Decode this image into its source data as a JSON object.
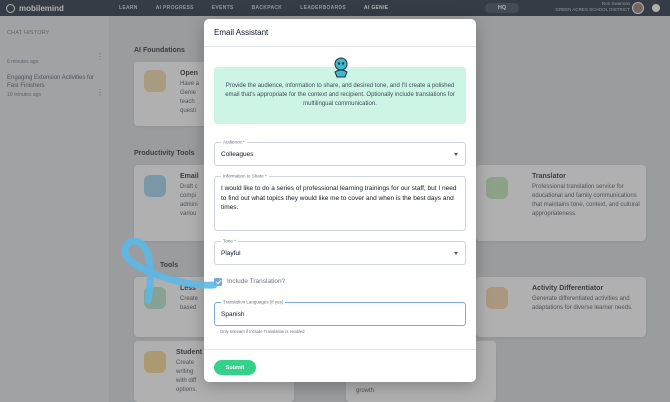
{
  "topbar": {
    "brand": "mobilemind",
    "nav": [
      "LEARN",
      "AI PROGRESS",
      "EVENTS",
      "BACKPACK",
      "LEADERBOARDS",
      "AI GENIE"
    ],
    "active_nav": "AI GENIE",
    "hq_label": "HQ",
    "user_name": "Ron Swanson",
    "user_org": "GREEN ACRES SCHOOL DISTRICT"
  },
  "sidebar": {
    "title": "CHAT HISTORY",
    "items": [
      {
        "title": "",
        "time": "6 minutes ago"
      },
      {
        "title": "Engaging Extension Activities for Fast Finishers",
        "time": "10 minutes ago"
      }
    ]
  },
  "main": {
    "sections": [
      "AI Foundations",
      "Productivity Tools",
      "Tools"
    ],
    "cards": [
      {
        "title": "Open",
        "desc": "Have a\nGenie\nteach\nquesti"
      },
      {
        "title": "Email",
        "desc": "Draft c\ncompi\nadmini\nvariou"
      },
      {
        "title": "Less",
        "desc": "Create\nbased"
      },
      {
        "title": "Student",
        "desc": "Create\nwriting\nwith diff\noptions."
      },
      {
        "title": "Translator",
        "desc": "Professional translation service for educational and family communications that maintains tone, context, and cultural appropriateness."
      },
      {
        "title": "Activity Differentiator",
        "desc": "Generate differentiated activities and adaptations for diverse learner needs."
      },
      {
        "title": "",
        "desc": "growth"
      }
    ]
  },
  "modal": {
    "title": "Email Assistant",
    "info": "Provide the audience, information to share, and desired tone, and I'll create a polished email that's appropriate for the context and recipient. Optionally include translations for multilingual communication.",
    "audience_label": "Audience *",
    "audience_value": "Colleagues",
    "info_label": "Information to Share *",
    "info_value": "I would like to do a series of professional learning trainings for our staff, but I need to find out what topics they would like me to cover and when is the best days and times.",
    "tone_label": "Tone *",
    "tone_value": "Playful",
    "checkbox_label": "Include Translation?",
    "translation_label": "Translation Languages (if yes)",
    "translation_value": "Spanish",
    "helper": "Only relevant if Include Translation is enabled",
    "submit_label": "Submit"
  },
  "colors": {
    "accent_green": "#33d18a",
    "info_bg": "#cdf5e6",
    "nav_bg": "#1f2c3c",
    "annotation_blue": "#5bb8e6"
  }
}
